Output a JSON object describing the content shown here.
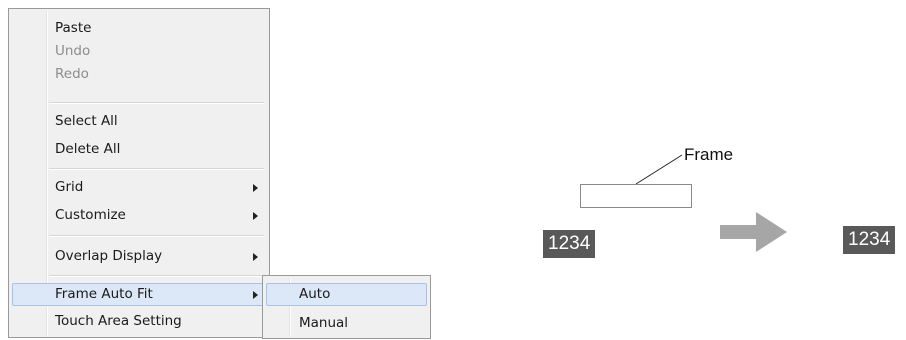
{
  "context_menu": {
    "items": [
      {
        "label": "Paste",
        "enabled": true
      },
      {
        "label": "Undo",
        "enabled": false
      },
      {
        "label": "Redo",
        "enabled": false
      },
      {
        "label": "Select All",
        "enabled": true
      },
      {
        "label": "Delete All",
        "enabled": true
      },
      {
        "label": "Grid",
        "enabled": true,
        "submenu": true
      },
      {
        "label": "Customize",
        "enabled": true,
        "submenu": true
      },
      {
        "label": "Overlap Display",
        "enabled": true,
        "submenu": true
      },
      {
        "label": "Frame Auto Fit",
        "enabled": true,
        "submenu": true,
        "highlighted": true
      },
      {
        "label": "Touch Area Setting",
        "enabled": true
      }
    ]
  },
  "submenu": {
    "items": [
      {
        "label": "Auto",
        "highlighted": true
      },
      {
        "label": "Manual"
      }
    ]
  },
  "illustration": {
    "frame_label": "Frame",
    "before_value": "1234",
    "after_value": "1234"
  },
  "colors": {
    "menu_bg": "#f0f0f0",
    "highlight_bg": "#dce8f7",
    "highlight_border": "#a7c3e8",
    "value_box_bg": "#595959",
    "arrow_gray": "#a6a6a6"
  }
}
